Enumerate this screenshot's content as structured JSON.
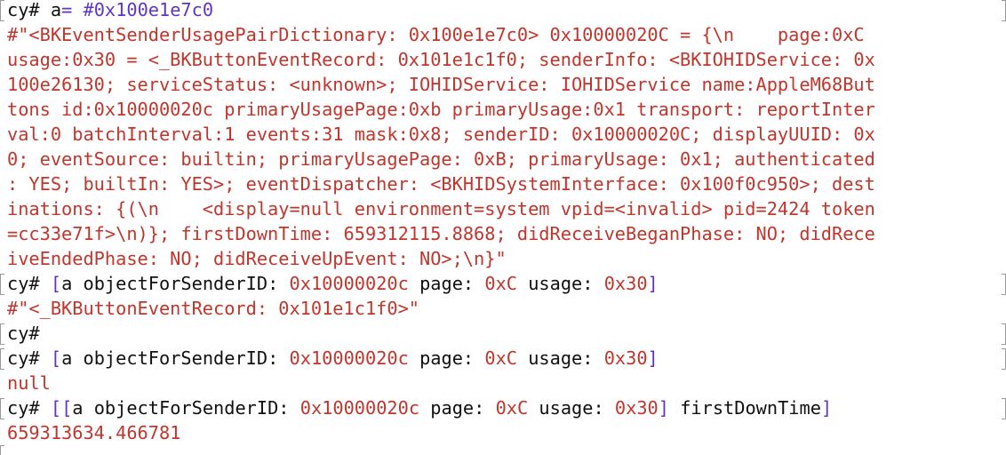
{
  "terminal": {
    "lines": [
      {
        "prompt": "cy#",
        "input_var": "a",
        "input_op": "=",
        "input_rest": "#0x100e1e7c0"
      },
      {
        "output": "#\"<BKEventSenderUsagePairDictionary: 0x100e1e7c0> 0x10000020C = {\\n    page:0xC"
      },
      {
        "output": "usage:0x30 = <_BKButtonEventRecord: 0x101e1c1f0; senderInfo: <BKIOHIDService: 0x"
      },
      {
        "output": "100e26130; serviceStatus: <unknown>; IOHIDService: IOHIDService name:AppleM68But"
      },
      {
        "output": "tons id:0x10000020c primaryUsagePage:0xb primaryUsage:0x1 transport: reportInter"
      },
      {
        "output": "val:0 batchInterval:1 events:31 mask:0x8; senderID: 0x10000020C; displayUUID: 0x"
      },
      {
        "output": "0; eventSource: builtin; primaryUsagePage: 0xB; primaryUsage: 0x1; authenticated"
      },
      {
        "output": ": YES; builtIn: YES>; eventDispatcher: <BKHIDSystemInterface: 0x100f0c950>; dest"
      },
      {
        "output": "inations: {(\\n    <display=null environment=system vpid=<invalid> pid=2424 token"
      },
      {
        "output": "=cc33e71f>\\n)}; firstDownTime: 659312115.8868; didReceiveBeganPhase: NO; didRece"
      },
      {
        "output": "iveEndedPhase: NO; didReceiveUpEvent: NO>;\\n}\""
      },
      {
        "prompt": "cy#",
        "cmd_open": "[",
        "cmd_obj": "a",
        "cmd_sel1": "objectForSenderID:",
        "cmd_arg1": "0x10000020c",
        "cmd_sel2": "page:",
        "cmd_arg2": "0xC",
        "cmd_sel3": "usage:",
        "cmd_arg3": "0x30",
        "cmd_close": "]"
      },
      {
        "output": "#\"<_BKButtonEventRecord: 0x101e1c1f0>\""
      },
      {
        "prompt": "cy#"
      },
      {
        "prompt": "cy#",
        "cmd_open": "[",
        "cmd_obj": "a",
        "cmd_sel1": "objectForSenderID:",
        "cmd_arg1": "0x10000020c",
        "cmd_sel2": "page:",
        "cmd_arg2": "0xC",
        "cmd_sel3": "usage:",
        "cmd_arg3": "0x30",
        "cmd_close": "]"
      },
      {
        "output": "null"
      },
      {
        "prompt": "cy#",
        "cmd_open": "[[",
        "cmd_obj": "a",
        "cmd_sel1": "objectForSenderID:",
        "cmd_arg1": "0x10000020c",
        "cmd_sel2": "page:",
        "cmd_arg2": "0xC",
        "cmd_sel3": "usage:",
        "cmd_arg3": "0x30",
        "cmd_close": "]",
        "cmd_tail": "firstDownTime",
        "cmd_close2": "]"
      },
      {
        "output": "659313634.466781"
      }
    ]
  },
  "colors": {
    "output": "#c0362c",
    "keyword": "#5f35c9",
    "text": "#111111",
    "background": "#ffffff"
  }
}
